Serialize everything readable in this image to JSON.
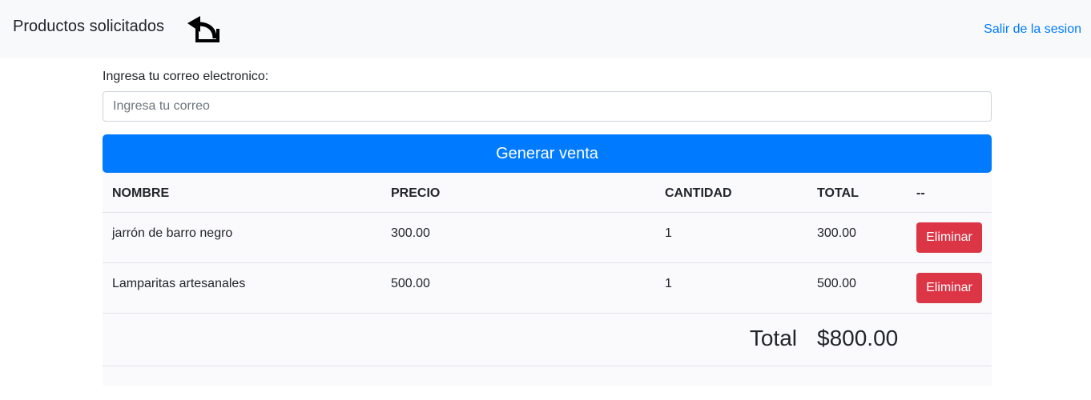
{
  "navbar": {
    "title": "Productos solicitados",
    "back_icon": "back-arrow-icon",
    "logout_label": "Salir de la sesion"
  },
  "form": {
    "email_label": "Ingresa tu correo electronico:",
    "email_placeholder": "Ingresa tu correo",
    "email_value": "",
    "submit_label": "Generar venta"
  },
  "table": {
    "headers": [
      "NOMBRE",
      "PRECIO",
      "CANTIDAD",
      "TOTAL",
      "--"
    ],
    "rows": [
      {
        "nombre": "jarrón de barro negro",
        "precio": "300.00",
        "cantidad": "1",
        "total": "300.00",
        "action": "Eliminar"
      },
      {
        "nombre": "Lamparitas artesanales",
        "precio": "500.00",
        "cantidad": "1",
        "total": "500.00",
        "action": "Eliminar"
      }
    ],
    "total_label": "Total",
    "total_value": "$800.00"
  },
  "colors": {
    "primary": "#007bff",
    "danger": "#dc3545",
    "navbar_bg": "#f8f9fa"
  }
}
